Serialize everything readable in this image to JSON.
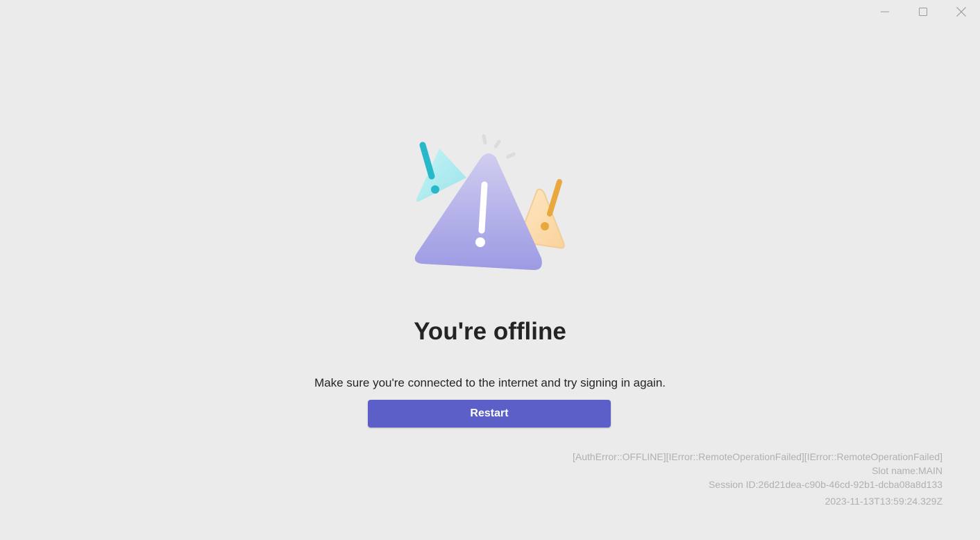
{
  "window_controls": {
    "minimize_icon": "minimize-icon",
    "maximize_icon": "maximize-icon",
    "close_icon": "close-icon"
  },
  "illustration": {
    "icon": "offline-warning-illustration",
    "colors": {
      "main_triangle": "#a9a6e6",
      "left_triangle": "#a5ecf0",
      "left_mark": "#27b9c9",
      "right_triangle": "#fcd9a4",
      "right_mark": "#e9a83d",
      "sparks": "#dcdcdc"
    }
  },
  "main": {
    "title": "You're offline",
    "message": "Make sure you're connected to the internet and try signing in again.",
    "restart_label": "Restart"
  },
  "diagnostics": {
    "error_codes": "[AuthError::OFFLINE][IError::RemoteOperationFailed][IError::RemoteOperationFailed]",
    "slot": "Slot name:MAIN",
    "session": "Session ID:26d21dea-c90b-46cd-92b1-dcba08a8d133",
    "timestamp": "2023-11-13T13:59:24.329Z"
  },
  "colors": {
    "background": "#ebebeb",
    "accent": "#5b5fc7",
    "text": "#242424",
    "muted_text": "#b0b0b0"
  }
}
